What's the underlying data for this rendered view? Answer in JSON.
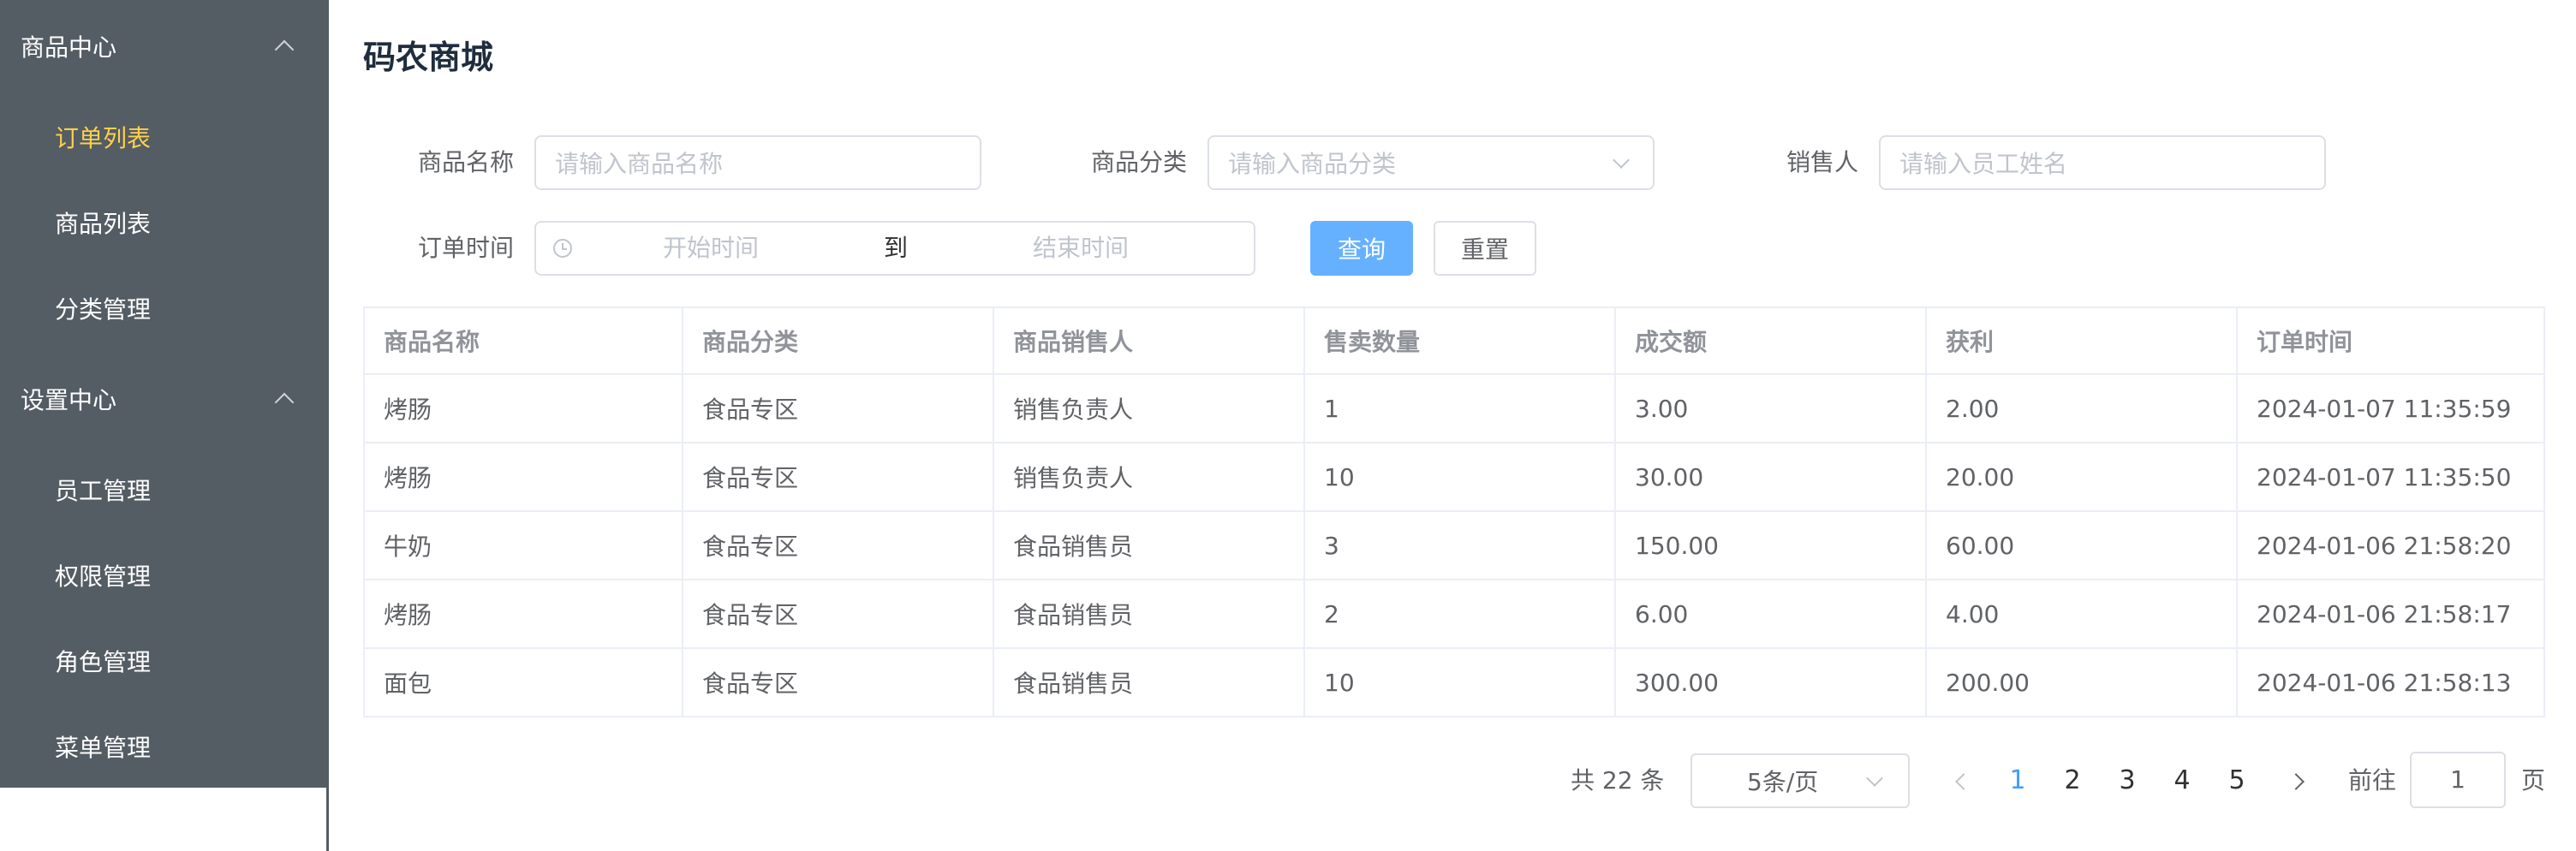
{
  "sidebar": {
    "groups": [
      {
        "label": "商品中心",
        "items": [
          "订单列表",
          "商品列表",
          "分类管理"
        ]
      },
      {
        "label": "设置中心",
        "items": [
          "员工管理",
          "权限管理",
          "角色管理",
          "菜单管理"
        ]
      }
    ],
    "active_item": "订单列表",
    "colors": {
      "background": "#545c64",
      "text": "#ffffff",
      "active": "#ffd04b"
    }
  },
  "page": {
    "title": "码农商城"
  },
  "filters": {
    "name_label": "商品名称",
    "name_placeholder": "请输入商品名称",
    "category_label": "商品分类",
    "category_placeholder": "请输入商品分类",
    "seller_label": "销售人",
    "seller_placeholder": "请输入员工姓名",
    "time_label": "订单时间",
    "start_placeholder": "开始时间",
    "range_separator": "到",
    "end_placeholder": "结束时间",
    "query_button": "查询",
    "reset_button": "重置"
  },
  "table": {
    "columns": [
      "商品名称",
      "商品分类",
      "商品销售人",
      "售卖数量",
      "成交额",
      "获利",
      "订单时间"
    ],
    "rows": [
      [
        "烤肠",
        "食品专区",
        "销售负责人",
        "1",
        "3.00",
        "2.00",
        "2024-01-07 11:35:59"
      ],
      [
        "烤肠",
        "食品专区",
        "销售负责人",
        "10",
        "30.00",
        "20.00",
        "2024-01-07 11:35:50"
      ],
      [
        "牛奶",
        "食品专区",
        "食品销售员",
        "3",
        "150.00",
        "60.00",
        "2024-01-06 21:58:20"
      ],
      [
        "烤肠",
        "食品专区",
        "食品销售员",
        "2",
        "6.00",
        "4.00",
        "2024-01-06 21:58:17"
      ],
      [
        "面包",
        "食品专区",
        "食品销售员",
        "10",
        "300.00",
        "200.00",
        "2024-01-06 21:58:13"
      ]
    ]
  },
  "pagination": {
    "total_text": "共 22 条",
    "page_size": "5条/页",
    "pages": [
      "1",
      "2",
      "3",
      "4",
      "5"
    ],
    "current_page": "1",
    "goto_label": "前往",
    "goto_value": "1",
    "page_suffix": "页",
    "active_color": "#409eff"
  },
  "colors": {
    "primary_button": "#66b1ff",
    "border": "#dcdfe6",
    "placeholder": "#c0c4cc"
  }
}
